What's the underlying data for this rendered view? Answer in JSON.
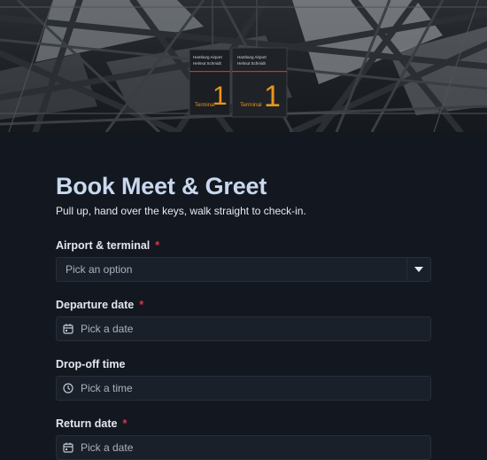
{
  "hero": {
    "signs": [
      {
        "line1": "Hamburg Airport",
        "line2": "Helmut Schmidt",
        "terminal_label": "Terminal",
        "terminal_number": "1"
      },
      {
        "line1": "Hamburg Airport",
        "line2": "Helmut Schmidt",
        "terminal_label": "Terminal",
        "terminal_number": "1"
      }
    ]
  },
  "form": {
    "title": "Book Meet & Greet",
    "subtitle": "Pull up, hand over the keys, walk straight to check-in.",
    "required_mark": "*",
    "fields": [
      {
        "label": "Airport & terminal",
        "required": true,
        "type": "select",
        "placeholder": "Pick an option",
        "icon": "chevron-down-icon"
      },
      {
        "label": "Departure date",
        "required": true,
        "type": "date",
        "placeholder": "Pick a date",
        "icon": "calendar-icon"
      },
      {
        "label": "Drop-off time",
        "required": false,
        "type": "time",
        "placeholder": "Pick a time",
        "icon": "clock-icon"
      },
      {
        "label": "Return date",
        "required": true,
        "type": "date",
        "placeholder": "Pick a date",
        "icon": "calendar-icon"
      }
    ]
  },
  "colors": {
    "background": "#131820",
    "title": "#c9d8ee",
    "required": "#e0334b",
    "input_bg": "#1a2029",
    "sign_accent": "#e8951e"
  }
}
